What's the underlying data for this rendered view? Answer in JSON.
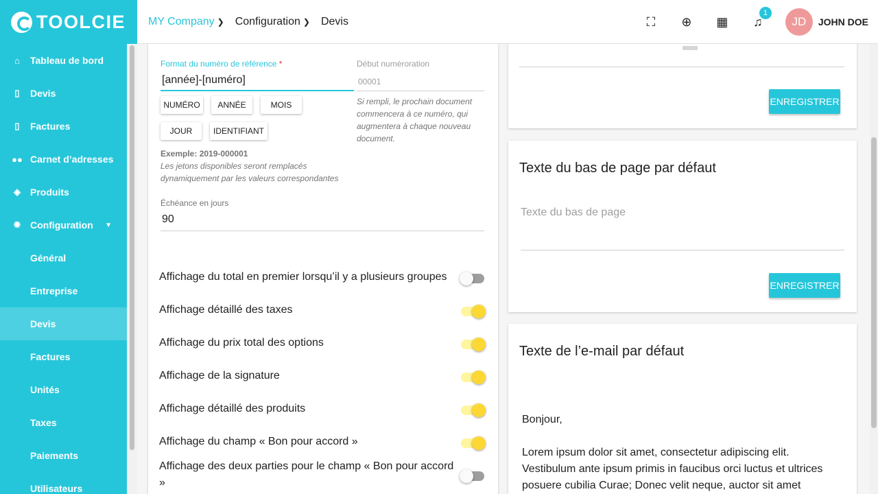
{
  "brand": {
    "name": "TOOLCIE"
  },
  "sidebar": {
    "items": [
      {
        "label": "Tableau de bord",
        "icon": "home-icon"
      },
      {
        "label": "Devis",
        "icon": "quote-icon"
      },
      {
        "label": "Factures",
        "icon": "invoice-icon"
      },
      {
        "label": "Carnet d’adresses",
        "icon": "contacts-icon"
      },
      {
        "label": "Produits",
        "icon": "products-icon"
      },
      {
        "label": "Configuration",
        "icon": "gear-icon"
      }
    ],
    "subitems": [
      {
        "label": "Général"
      },
      {
        "label": "Entreprise"
      },
      {
        "label": "Devis",
        "active": true
      },
      {
        "label": "Factures"
      },
      {
        "label": "Unités"
      },
      {
        "label": "Taxes"
      },
      {
        "label": "Paiements"
      },
      {
        "label": "Utilisateurs"
      }
    ]
  },
  "header": {
    "breadcrumbs": [
      "MY Company",
      "Configuration",
      "Devis"
    ],
    "notification_count": "1",
    "avatar_initials": "JD",
    "username": "JOHN DOE"
  },
  "form": {
    "ref_format_label": "Format du numéro de référence",
    "ref_format_value": "[année]-[numéro]",
    "start_num_label": "Début numéroration",
    "start_num_placeholder": "00001",
    "start_num_help": "Si rempli, le prochain document commencera à ce numéro, qui augmentera à chaque nouveau document.",
    "tokens": [
      "NUMÉRO",
      "ANNÉE",
      "MOIS",
      "JOUR",
      "IDENTIFIANT"
    ],
    "example": "Exemple: 2019-000001",
    "tokens_help": "Les jetons disponibles seront remplacés dynamiquement par les valeurs correspondantes",
    "due_label": "Échéance en jours",
    "due_value": "90"
  },
  "toggles": [
    {
      "label": "Affichage du total en premier lorsqu’il y a plusieurs groupes",
      "on": false
    },
    {
      "label": "Affichage détaillé des taxes",
      "on": true
    },
    {
      "label": "Affichage du prix total des options",
      "on": true
    },
    {
      "label": "Affichage de la signature",
      "on": true
    },
    {
      "label": "Affichage détaillé des produits",
      "on": true
    },
    {
      "label": "Affichage du champ « Bon pour accord »",
      "on": true
    },
    {
      "label": "Affichage des deux parties pour le champ « Bon pour accord »",
      "on": false
    }
  ],
  "cards": {
    "save_label": "ENREGISTRER",
    "footer_title": "Texte du bas de page par défaut",
    "footer_placeholder": "Texte du bas de page",
    "email_title": "Texte de l’e-mail par défaut",
    "email_greeting": "Bonjour,",
    "email_body": "Lorem ipsum dolor sit amet, consectetur adipiscing elit. Vestibulum ante ipsum primis in faucibus orci luctus et ultrices posuere cubilia Curae; Donec velit neque, auctor sit amet"
  }
}
